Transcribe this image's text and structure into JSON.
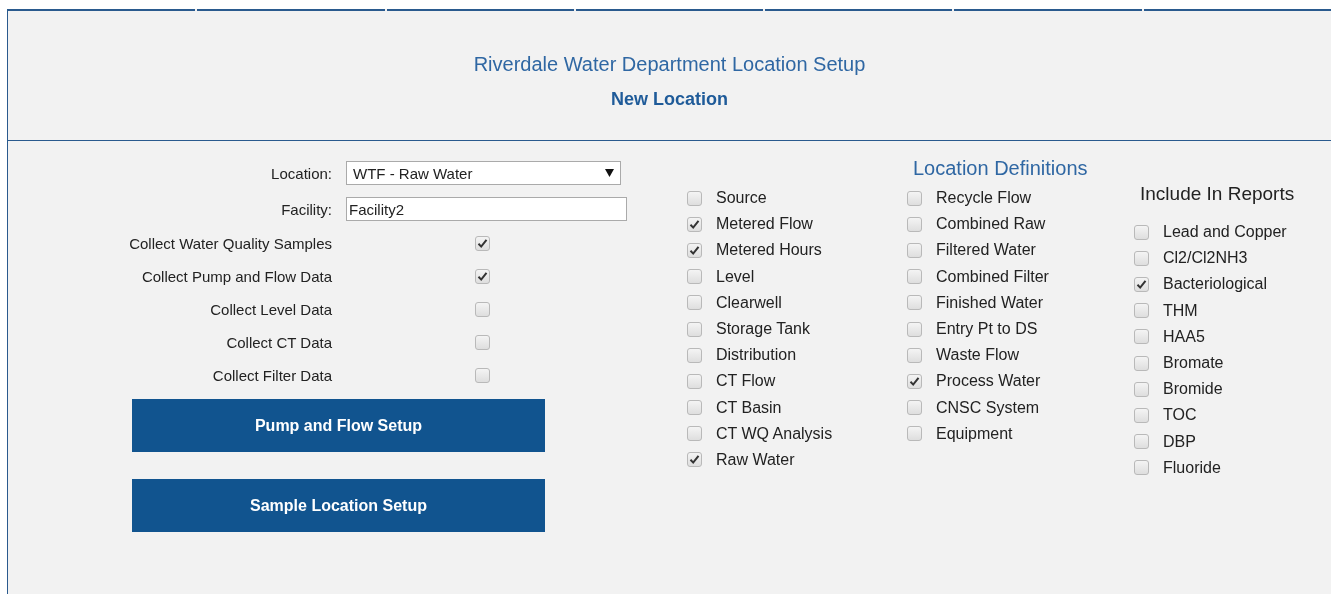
{
  "header": {
    "title": "Riverdale Water Department Location Setup",
    "subtitle": "New Location"
  },
  "form": {
    "location": {
      "label": "Location:",
      "value": "WTF - Raw Water"
    },
    "facility": {
      "label": "Facility:",
      "value": "Facility2"
    },
    "options": [
      {
        "label": "Collect Water Quality Samples",
        "checked": true
      },
      {
        "label": "Collect Pump and Flow Data",
        "checked": true
      },
      {
        "label": "Collect Level Data",
        "checked": false
      },
      {
        "label": "Collect CT Data",
        "checked": false
      },
      {
        "label": "Collect Filter Data",
        "checked": false
      }
    ],
    "buttons": [
      "Pump and Flow Setup",
      "Sample Location Setup"
    ]
  },
  "definitions": {
    "title": "Location Definitions",
    "column_1": [
      {
        "label": "Source",
        "checked": false
      },
      {
        "label": "Metered Flow",
        "checked": true
      },
      {
        "label": "Metered Hours",
        "checked": true
      },
      {
        "label": "Level",
        "checked": false
      },
      {
        "label": "Clearwell",
        "checked": false
      },
      {
        "label": "Storage Tank",
        "checked": false
      },
      {
        "label": "Distribution",
        "checked": false
      },
      {
        "label": "CT Flow",
        "checked": false
      },
      {
        "label": "CT Basin",
        "checked": false
      },
      {
        "label": "CT WQ Analysis",
        "checked": false
      },
      {
        "label": "Raw Water",
        "checked": true
      }
    ],
    "column_2": [
      {
        "label": "Recycle Flow",
        "checked": false
      },
      {
        "label": "Combined Raw",
        "checked": false
      },
      {
        "label": "Filtered Water",
        "checked": false
      },
      {
        "label": "Combined Filter",
        "checked": false
      },
      {
        "label": "Finished Water",
        "checked": false
      },
      {
        "label": "Entry Pt to DS",
        "checked": false
      },
      {
        "label": "Waste Flow",
        "checked": false
      },
      {
        "label": "Process Water",
        "checked": true
      },
      {
        "label": "CNSC System",
        "checked": false
      },
      {
        "label": "Equipment",
        "checked": false
      }
    ]
  },
  "reports": {
    "title": "Include In Reports",
    "items": [
      {
        "label": "Lead and Copper",
        "checked": false
      },
      {
        "label": "Cl2/Cl2NH3",
        "checked": false
      },
      {
        "label": "Bacteriological",
        "checked": true
      },
      {
        "label": "THM",
        "checked": false
      },
      {
        "label": "HAA5",
        "checked": false
      },
      {
        "label": "Bromate",
        "checked": false
      },
      {
        "label": "Bromide",
        "checked": false
      },
      {
        "label": "TOC",
        "checked": false
      },
      {
        "label": "DBP",
        "checked": false
      },
      {
        "label": "Fluoride",
        "checked": false
      }
    ]
  }
}
